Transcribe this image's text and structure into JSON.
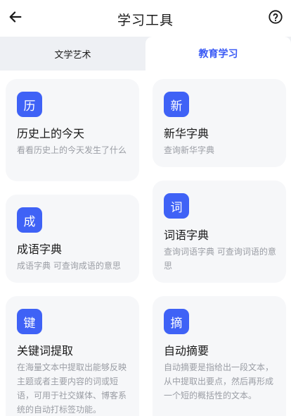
{
  "header": {
    "title": "学习工具",
    "back_icon": "arrow-left-icon",
    "help_icon": "question-circle-icon"
  },
  "tabs": [
    {
      "label": "文学艺术",
      "active": false
    },
    {
      "label": "教育学习",
      "active": true
    }
  ],
  "accent_color": "#3f62f6",
  "tools": [
    {
      "badge": "历",
      "title": "历史上的今天",
      "desc": "看看历史上的今天发生了什么"
    },
    {
      "badge": "新",
      "title": "新华字典",
      "desc": "查询新华字典"
    },
    {
      "badge": "成",
      "title": "成语字典",
      "desc": "成语字典 可查询成语的意思"
    },
    {
      "badge": "词",
      "title": "词语字典",
      "desc": "查询词语字典 可查询词语的意思"
    },
    {
      "badge": "键",
      "title": "关键词提取",
      "desc": "在海量文本中提取出能够反映主题或者主要内容的词或短语，可用于社交媒体、博客系统的自动打标签功能。"
    },
    {
      "badge": "摘",
      "title": "自动摘要",
      "desc": "自动摘要是指给出一段文本，从中提取出要点，然后再形成一个短的概括性的文本。"
    }
  ]
}
